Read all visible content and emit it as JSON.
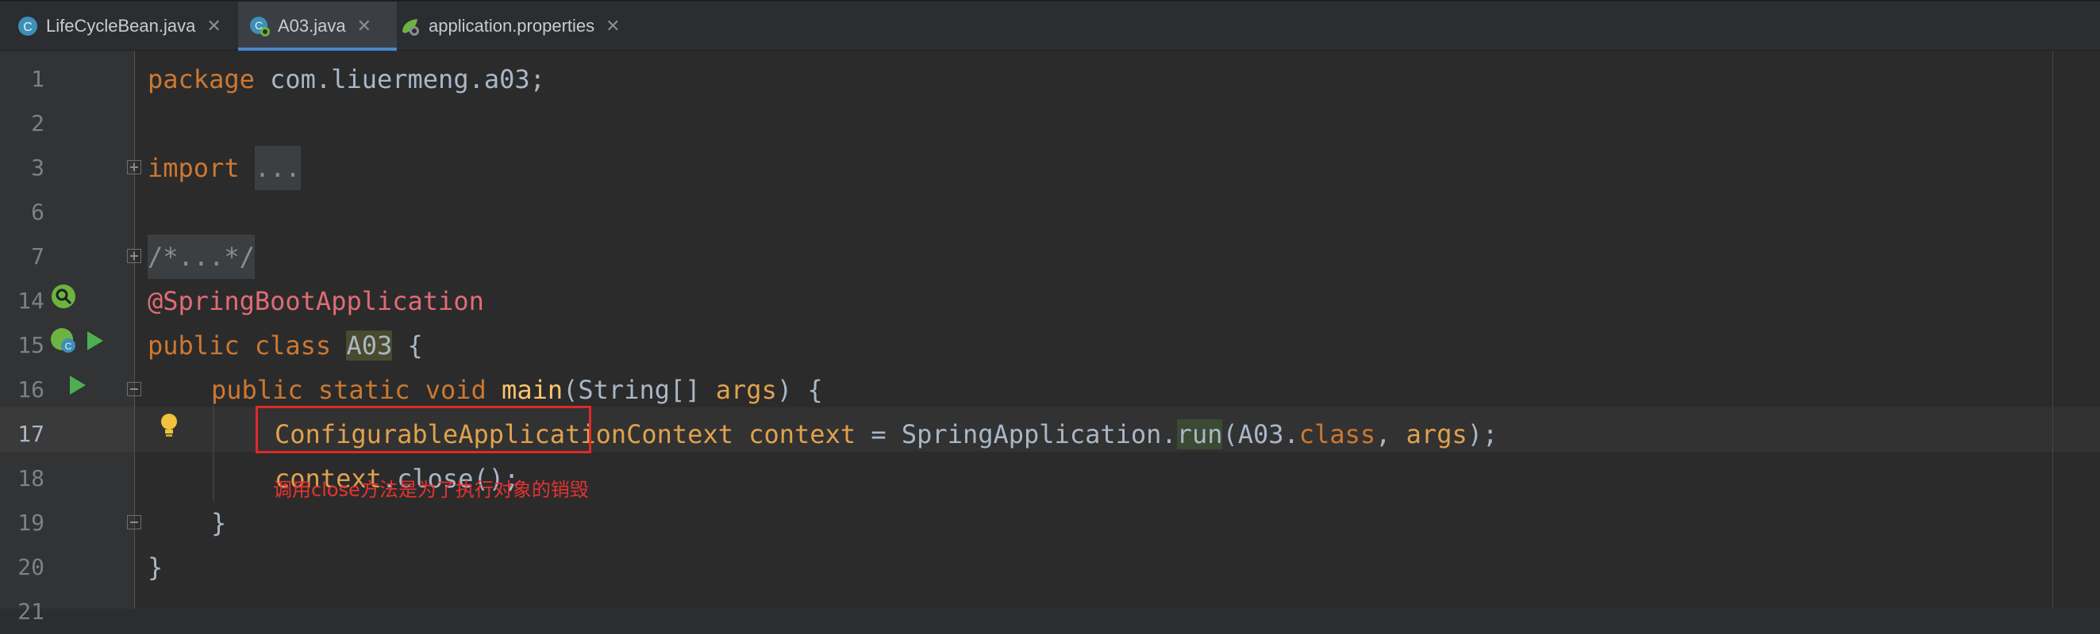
{
  "tabs": [
    {
      "label": "LifeCycleBean.java",
      "icon": "java-class-icon",
      "active": false
    },
    {
      "label": "A03.java",
      "icon": "spring-class-icon",
      "active": true
    },
    {
      "label": "application.properties",
      "icon": "spring-properties-icon",
      "active": false
    }
  ],
  "close_glyph": "✕",
  "lines": {
    "numbers": [
      "1",
      "2",
      "3",
      "6",
      "7",
      "14",
      "15",
      "16",
      "17",
      "18",
      "19",
      "20",
      "21"
    ],
    "l1": {
      "kw": "package",
      "rest": " com.liuermeng.a03;"
    },
    "l3": {
      "kw": "import",
      "folded": "..."
    },
    "l7": {
      "folded": "/*...*/"
    },
    "l14": {
      "annotation": "@SpringBootApplication"
    },
    "l15": {
      "kw1": "public",
      "kw2": "class",
      "name": "A03",
      "rest": " {"
    },
    "l16": {
      "kw1": "public",
      "kw2": "static",
      "kw3": "void",
      "method": "main",
      "open": "(String[] ",
      "param": "args",
      "close": ") {"
    },
    "l17": {
      "type": "ConfigurableApplicationContext",
      "var": "context",
      "eq": " = SpringApplication.",
      "run": "run",
      "open": "(A03.",
      "kwclass": "class",
      "comma": ", ",
      "param": "args",
      "end": ");"
    },
    "l18": {
      "var": "context",
      "rest": ".close();"
    },
    "l19": {
      "text": "}"
    },
    "l20": {
      "text": "}"
    }
  },
  "annotation_note": "调用close方法是为了执行对象的销毁",
  "colors": {
    "keyword": "#cc7832",
    "annotation": "#e06c75",
    "highlight_box": "#e02828",
    "tab_underline": "#4a88c7"
  }
}
